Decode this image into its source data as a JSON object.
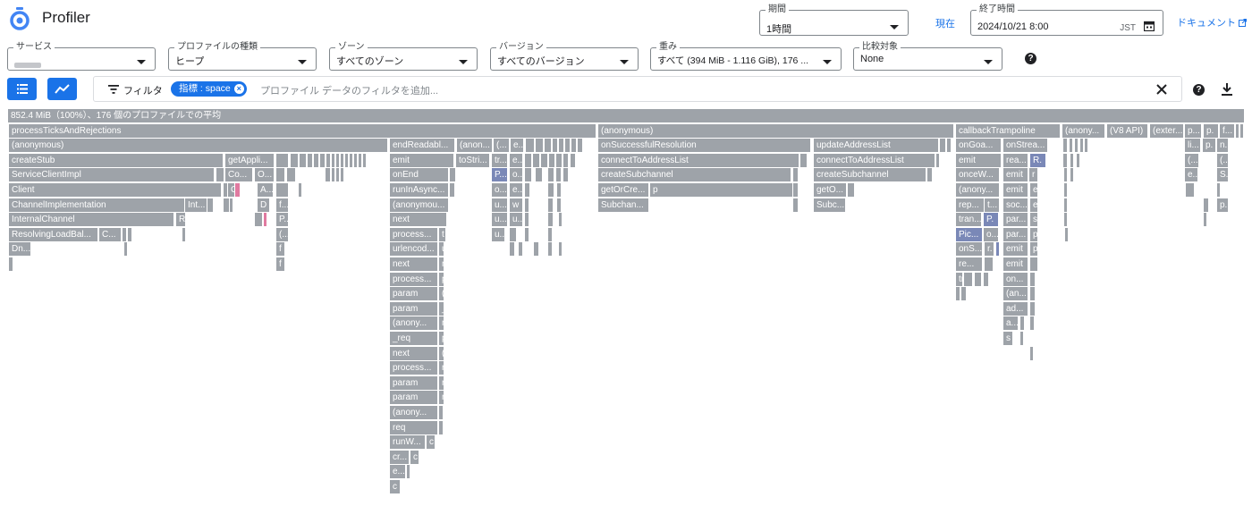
{
  "header": {
    "app_title": "Profiler",
    "period": {
      "label": "期間",
      "value": "1時間"
    },
    "now_link": "現在",
    "end_time": {
      "label": "終了時間",
      "value": "2024/10/21 8:00",
      "tz": "JST"
    },
    "docs_link": "ドキュメント"
  },
  "selectors": {
    "service": {
      "label": "サービス",
      "value": ""
    },
    "profile_type": {
      "label": "プロファイルの種類",
      "value": "ヒープ"
    },
    "zone": {
      "label": "ゾーン",
      "value": "すべてのゾーン"
    },
    "version": {
      "label": "バージョン",
      "value": "すべてのバージョン"
    },
    "weight": {
      "label": "重み",
      "value": "すべて (394 MiB - 1.116 GiB), 176 ..."
    },
    "compare": {
      "label": "比較対象",
      "value": "None"
    }
  },
  "filter": {
    "label": "フィルタ",
    "chip": "指標 : space",
    "placeholder": "プロファイル データのフィルタを追加..."
  },
  "colors": {
    "accent": "#1a73e8",
    "frame": "#9ea3a9",
    "frame_blue": "#7a88b7",
    "frame_teal": "#2e8b80",
    "frame_pink": "#e07aa0"
  },
  "flame": {
    "root": "852.4 MiB（100%）、176 個のプロファイルでの平均",
    "frames": [
      "processTicksAndRejections",
      "(anonymous)",
      "createStub",
      "getAppli...",
      "ServiceClientImpl",
      "Co...",
      "O...",
      "Client",
      "G",
      "A...",
      "ChannelImplementation",
      "Int...",
      "D",
      "f...",
      "InternalChannel",
      "R.",
      "P...",
      "ResolvingLoadBal...",
      "C...",
      "(...",
      "Dn...",
      "f",
      "endReadabl...",
      "(anon...",
      "(...",
      "e...",
      "emit",
      "toStri...",
      "tr...",
      "onEnd",
      "P...",
      "o...",
      "runInAsync...",
      "o...",
      "e...",
      "(anonymou...",
      "u...",
      "w",
      "next",
      "u...",
      "process...",
      "t",
      "urlencod...",
      "u",
      "next",
      "n",
      "process...",
      "p",
      "param",
      "(",
      "param",
      "_",
      "(anony...",
      "n",
      "_req",
      "p",
      "next",
      "(",
      "process...",
      "r",
      "param",
      "r",
      "param",
      "r",
      "(anony...",
      "req",
      "runW...",
      "c",
      "cr...",
      "c",
      "e...",
      "c",
      "(anonymous)",
      "onSuccessfulResolution",
      "updateAddressList",
      "connectToAddressList",
      "connectToAddressList",
      "createSubchannel",
      "createSubchannel",
      "getOrCre...",
      "p",
      "getO...",
      "Subchan...",
      "Subc...",
      "u",
      "callbackTrampoline",
      "(anony...",
      "(V8 API)",
      "(exter...",
      "p...",
      "p.",
      "f...",
      "onGoa...",
      "onStrea...",
      "li...",
      "p.",
      "n.",
      "emit",
      "rea...",
      "R.",
      "(...",
      "(...",
      "onceW...",
      "emit",
      "r",
      "e...",
      "S.",
      "(anony...",
      "emit",
      "e",
      "rep...",
      "t...",
      "soc...",
      "e",
      "p.",
      "tran...",
      "P.",
      "par...",
      "s",
      "Pic...",
      "o...",
      "par...",
      "p",
      "onS...",
      "r.",
      "emit",
      "p",
      "re...",
      "emit",
      "on...",
      "(an...",
      "ad...",
      "a...",
      "s"
    ]
  }
}
